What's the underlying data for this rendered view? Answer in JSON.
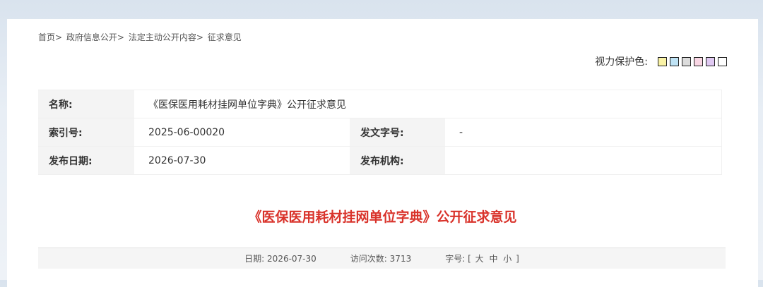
{
  "breadcrumb": {
    "items": [
      "首页",
      "政府信息公开",
      "法定主动公开内容",
      "征求意见"
    ],
    "separator": ">"
  },
  "eye_protection": {
    "label": "视力保护色:",
    "swatches": [
      "#faf3a6",
      "#bfe3f5",
      "#dcdcdc",
      "#f9d6e4",
      "#e0c9f2",
      "#ffffff"
    ]
  },
  "meta": {
    "name_label": "名称:",
    "name_value": "《医保医用耗材挂网单位字典》公开征求意见",
    "index_label": "索引号:",
    "index_value": "2025-06-00020",
    "docno_label": "发文字号:",
    "docno_value": "-",
    "date_label": "发布日期:",
    "date_value": "2026-07-30",
    "org_label": "发布机构:",
    "org_value": ""
  },
  "article": {
    "title": "《医保医用耗材挂网单位字典》公开征求意见"
  },
  "infobar": {
    "date_label": "日期:",
    "date_value": "2026-07-30",
    "visits_label": "访问次数:",
    "visits_value": "3713",
    "font_label": "字号:",
    "bracket_open": "[",
    "font_large": "大",
    "font_medium": "中",
    "font_small": "小",
    "bracket_close": "]"
  }
}
